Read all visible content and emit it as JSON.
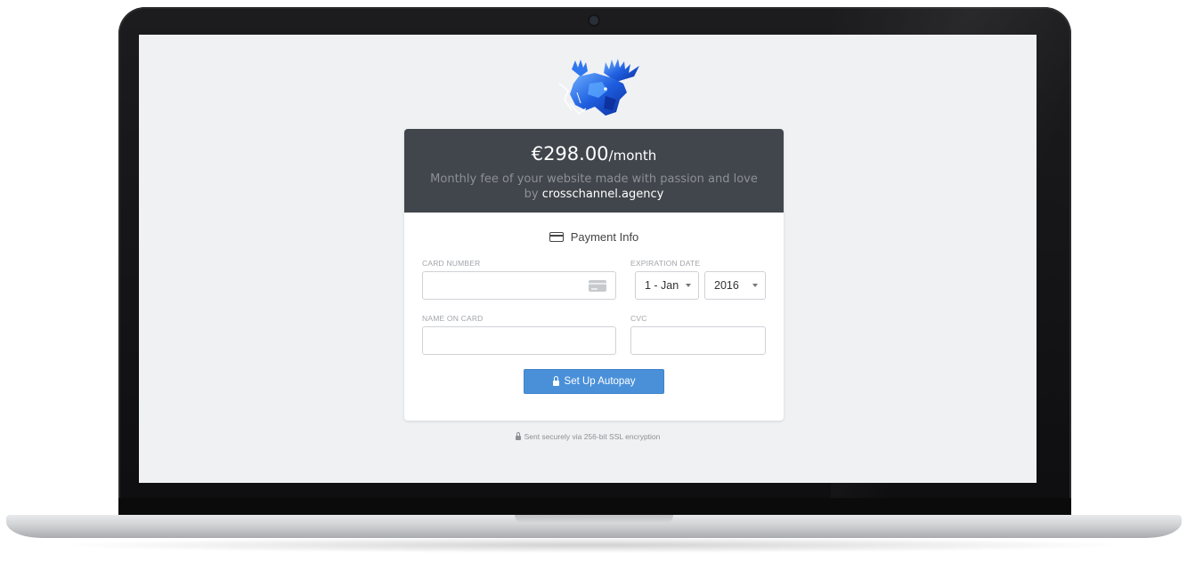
{
  "header": {
    "price_amount": "€298.00",
    "price_period": "/month",
    "description_text": "Monthly fee of your website made with passion and love by",
    "agency": "crosschannel.agency"
  },
  "form": {
    "section_title": "Payment Info",
    "card_number_label": "CARD NUMBER",
    "card_number_value": "",
    "expiration_label": "EXPIRATION DATE",
    "month_selected": "1 - Jan",
    "year_selected": "2016",
    "name_label": "NAME ON CARD",
    "name_value": "",
    "cvc_label": "CVC",
    "cvc_value": "",
    "submit_label": "Set Up Autopay"
  },
  "footer": {
    "secure_note": "Sent securely via 256-bit SSL encryption"
  },
  "colors": {
    "header_bg": "#41464c",
    "button_bg": "#4a90d9",
    "screen_bg": "#f0f1f3"
  },
  "icons": {
    "logo": "moose-logo",
    "section": "credit-card-icon",
    "button": "lock-icon",
    "card_input": "credit-card-icon",
    "footer": "lock-icon"
  }
}
